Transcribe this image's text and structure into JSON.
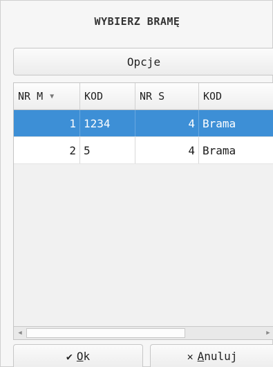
{
  "dialog": {
    "title": "WYBIERZ BRAMĘ",
    "options_label": "Opcje"
  },
  "grid": {
    "columns": [
      {
        "label": "NR M",
        "sorted": "descending"
      },
      {
        "label": "KOD"
      },
      {
        "label": "NR S"
      },
      {
        "label": "KOD"
      }
    ],
    "rows": [
      {
        "nr_m": "1",
        "kod": "1234",
        "nr_s": "4",
        "kod2": "Brama",
        "selected": true
      },
      {
        "nr_m": "2",
        "kod": "5",
        "nr_s": "4",
        "kod2": "Brama",
        "selected": false
      }
    ]
  },
  "footer": {
    "ok": {
      "accel": "O",
      "rest": "k",
      "icon": "check-icon"
    },
    "cancel": {
      "accel": "A",
      "rest": "nuluj",
      "icon": "close-icon"
    }
  },
  "colors": {
    "selection": "#3d8fd6",
    "background": "#f6f6f6"
  }
}
